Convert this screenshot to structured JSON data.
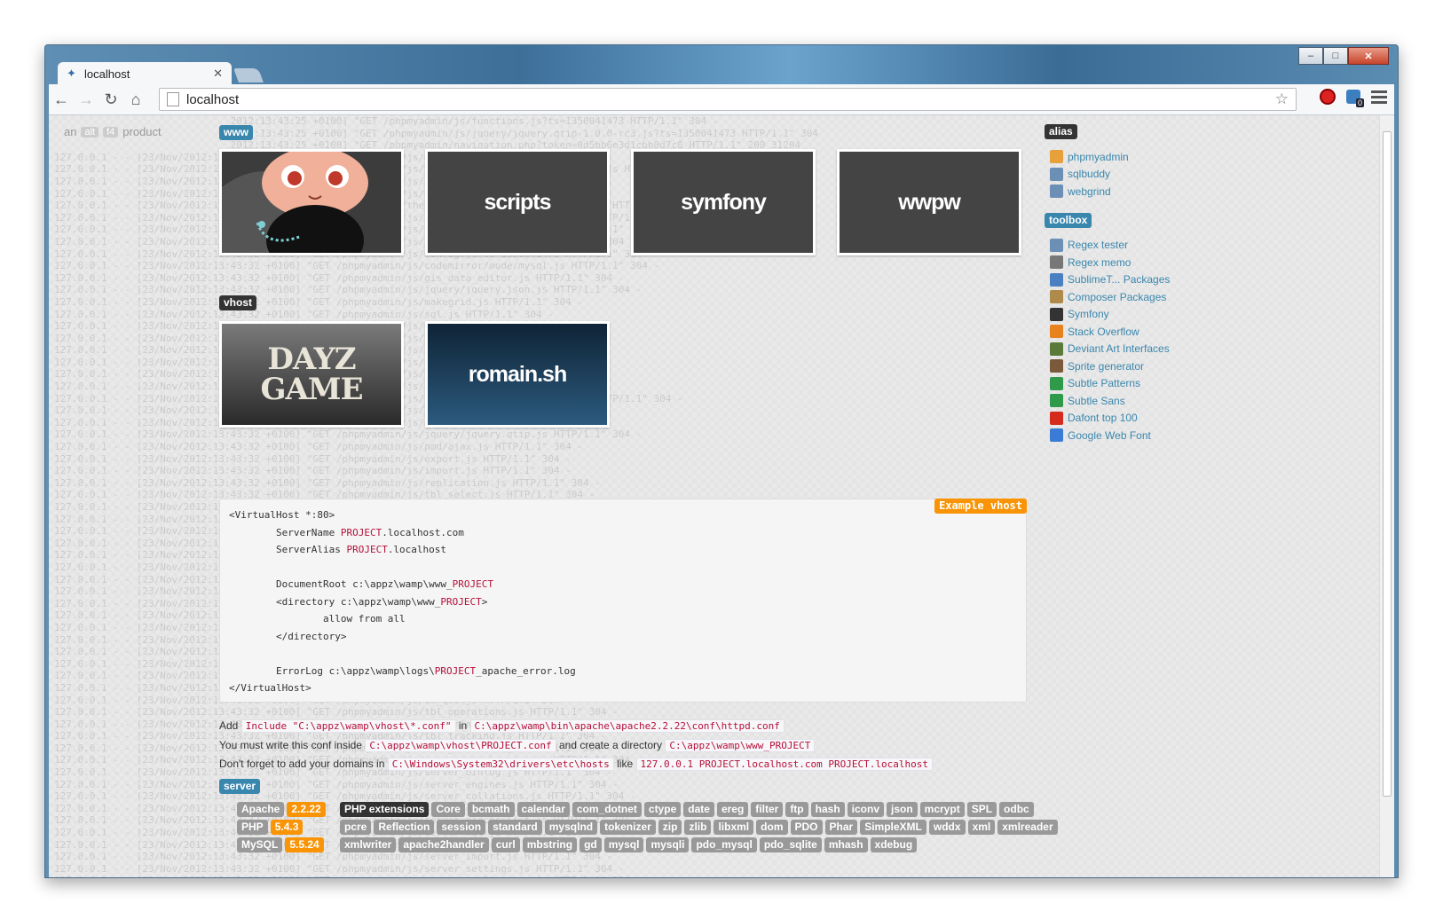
{
  "browser": {
    "tab_title": "localhost",
    "url": "localhost",
    "window_controls": [
      "minimize",
      "maximize",
      "close"
    ]
  },
  "page": {
    "anprod": {
      "pre": "an",
      "key1": "alt",
      "key2": "f4",
      "post": "product"
    },
    "www_label": "www",
    "www_items": [
      "octocat",
      "scripts",
      "symfony",
      "wwpw"
    ],
    "vhost_label": "vhost",
    "vhost_items": [
      "DAYZ GAME",
      "romain.sh"
    ],
    "example_label": "Example vhost",
    "vhost_example": {
      "l1": "<VirtualHost *:80>",
      "l2a": "        ServerName ",
      "l2b": "PROJECT",
      "l2c": ".localhost.com",
      "l3a": "        ServerAlias ",
      "l3b": "PROJECT",
      "l3c": ".localhost",
      "l4a": "        DocumentRoot c:\\appz\\wamp\\www_",
      "l4b": "PROJECT",
      "l5a": "        <directory c:\\appz\\wamp\\www_",
      "l5b": "PROJECT",
      "l5c": ">",
      "l6": "                allow from all",
      "l7": "        </directory>",
      "l8a": "        ErrorLog c:\\appz\\wamp\\logs\\",
      "l8b": "PROJECT",
      "l8c": "_apache_error.log",
      "l9": "</VirtualHost>"
    },
    "notes": {
      "n1_a": "Add",
      "n1_code1": "Include \"C:\\appz\\wamp\\vhost\\*.conf\"",
      "n1_b": "in",
      "n1_code2": "C:\\appz\\wamp\\bin\\apache\\apache2.2.22\\conf\\httpd.conf",
      "n2_a": "You must write this conf inside",
      "n2_code1": "C:\\appz\\wamp\\vhost\\PROJECT.conf",
      "n2_b": "and create a directory",
      "n2_code2": "C:\\appz\\wamp\\www_PROJECT",
      "n3_a": "Don't forget to add your domains in",
      "n3_code1": "C:\\Windows\\System32\\drivers\\etc\\hosts",
      "n3_b": "like",
      "n3_code2": "127.0.0.1 PROJECT.localhost.com PROJECT.localhost"
    },
    "server_label": "server",
    "server": [
      {
        "name": "Apache",
        "version": "2.2.22"
      },
      {
        "name": "PHP",
        "version": "5.4.3"
      },
      {
        "name": "MySQL",
        "version": "5.5.24"
      }
    ],
    "php_ext_label": "PHP extensions",
    "php_ext_row1": [
      "Core",
      "bcmath",
      "calendar",
      "com_dotnet",
      "ctype",
      "date",
      "ereg",
      "filter",
      "ftp",
      "hash",
      "iconv",
      "json",
      "mcrypt",
      "SPL",
      "odbc"
    ],
    "php_ext_row2": [
      "pcre",
      "Reflection",
      "session",
      "standard",
      "mysqlnd",
      "tokenizer",
      "zip",
      "zlib",
      "libxml",
      "dom",
      "PDO",
      "Phar",
      "SimpleXML",
      "wddx",
      "xml",
      "xmlreader"
    ],
    "php_ext_row3": [
      "xmlwriter",
      "apache2handler",
      "curl",
      "mbstring",
      "gd",
      "mysql",
      "mysqli",
      "pdo_mysql",
      "pdo_sqlite",
      "mhash",
      "xdebug"
    ]
  },
  "sidebar": {
    "alias_label": "alias",
    "alias": [
      {
        "label": "phpmyadmin",
        "icon": "pma-icon",
        "color": "#e6a13a"
      },
      {
        "label": "sqlbuddy",
        "icon": "wrench-icon",
        "color": "#6b8fb5"
      },
      {
        "label": "webgrind",
        "icon": "wrench-icon",
        "color": "#6b8fb5"
      }
    ],
    "toolbox_label": "toolbox",
    "toolbox": [
      {
        "label": "Regex tester",
        "icon": "wrench-icon",
        "color": "#6b8fb5"
      },
      {
        "label": "Regex memo",
        "icon": "memo-icon",
        "color": "#777777"
      },
      {
        "label": "SublimeT... Packages",
        "icon": "sublime-icon",
        "color": "#4a7fc1"
      },
      {
        "label": "Composer Packages",
        "icon": "composer-icon",
        "color": "#b08a4a"
      },
      {
        "label": "Symfony",
        "icon": "symfony-icon",
        "color": "#333333"
      },
      {
        "label": "Stack Overflow",
        "icon": "stackoverflow-icon",
        "color": "#e8821e"
      },
      {
        "label": "Deviant Art Interfaces",
        "icon": "deviantart-icon",
        "color": "#5a7a3a"
      },
      {
        "label": "Sprite generator",
        "icon": "sprite-icon",
        "color": "#7a5a3a"
      },
      {
        "label": "Subtle Patterns",
        "icon": "subtlepatterns-icon",
        "color": "#2e9a4a"
      },
      {
        "label": "Subtle Sans",
        "icon": "subtlesans-icon",
        "color": "#2e9a4a"
      },
      {
        "label": "Dafont top 100",
        "icon": "dafont-icon",
        "color": "#d52b1e"
      },
      {
        "label": "Google Web Font",
        "icon": "google-icon",
        "color": "#3a7bd5"
      }
    ]
  }
}
